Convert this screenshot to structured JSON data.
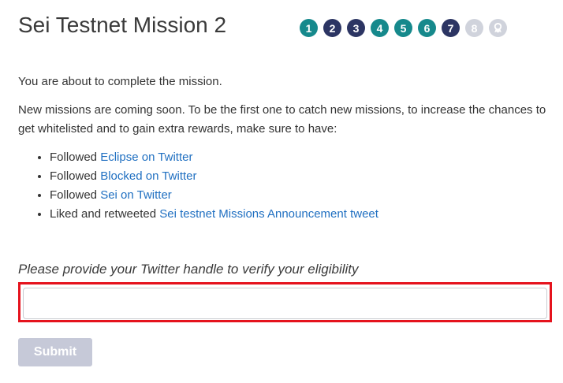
{
  "header": {
    "title": "Sei Testnet Mission 2",
    "steps": [
      {
        "label": "1",
        "state": "complete",
        "color": "#16898c"
      },
      {
        "label": "2",
        "state": "complete",
        "color": "#2c3563"
      },
      {
        "label": "3",
        "state": "complete",
        "color": "#2c3563"
      },
      {
        "label": "4",
        "state": "complete",
        "color": "#16898c"
      },
      {
        "label": "5",
        "state": "complete",
        "color": "#16898c"
      },
      {
        "label": "6",
        "state": "complete",
        "color": "#16898c"
      },
      {
        "label": "7",
        "state": "complete",
        "color": "#2c3563"
      },
      {
        "label": "8",
        "state": "pending",
        "color": "#d0d3dc"
      },
      {
        "label": "",
        "state": "pending",
        "icon": "award-icon",
        "color": "#d0d3dc"
      }
    ]
  },
  "content": {
    "intro": "You are about to complete the mission.",
    "description": "New missions are coming soon. To be the first one to catch new missions, to increase the chances to get whitelisted and to gain extra rewards, make sure to have:",
    "checklist": [
      {
        "prefix": "Followed ",
        "link": "Eclipse on Twitter"
      },
      {
        "prefix": "Followed ",
        "link": "Blocked on Twitter"
      },
      {
        "prefix": "Followed ",
        "link": "Sei on Twitter"
      },
      {
        "prefix": "Liked and retweeted ",
        "link": "Sei testnet Missions Announcement tweet"
      }
    ]
  },
  "form": {
    "label": "Please provide your Twitter handle to verify your eligibility",
    "input_value": "",
    "input_placeholder": "",
    "submit_label": "Submit"
  },
  "colors": {
    "link": "#1f6fc1",
    "highlight_border": "#e5131d",
    "submit_disabled": "#c6c9d8"
  }
}
